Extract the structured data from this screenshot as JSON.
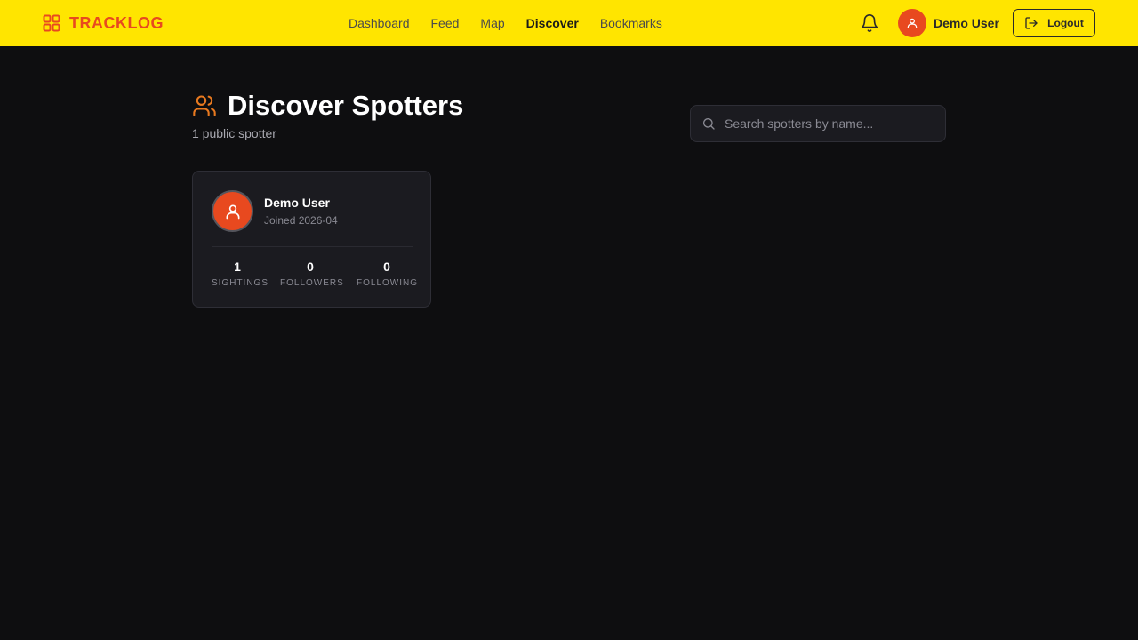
{
  "brand": {
    "name": "TRACKLOG",
    "color": "#e8491f"
  },
  "nav": {
    "items": [
      {
        "label": "Dashboard",
        "active": false
      },
      {
        "label": "Feed",
        "active": false
      },
      {
        "label": "Map",
        "active": false
      },
      {
        "label": "Discover",
        "active": true
      },
      {
        "label": "Bookmarks",
        "active": false
      }
    ]
  },
  "header": {
    "user_name": "Demo User",
    "logout_label": "Logout",
    "bell_icon": "bell-icon",
    "bar_color": "#ffe500"
  },
  "page": {
    "title": "Discover Spotters",
    "subtitle": "1 public spotter",
    "title_icon": "users-icon"
  },
  "search": {
    "placeholder": "Search spotters by name...",
    "value": ""
  },
  "spotters": [
    {
      "name": "Demo User",
      "joined": "Joined 2026-04",
      "stats": [
        {
          "value": "1",
          "label": "Sightings"
        },
        {
          "value": "0",
          "label": "Followers"
        },
        {
          "value": "0",
          "label": "Following"
        }
      ]
    }
  ]
}
